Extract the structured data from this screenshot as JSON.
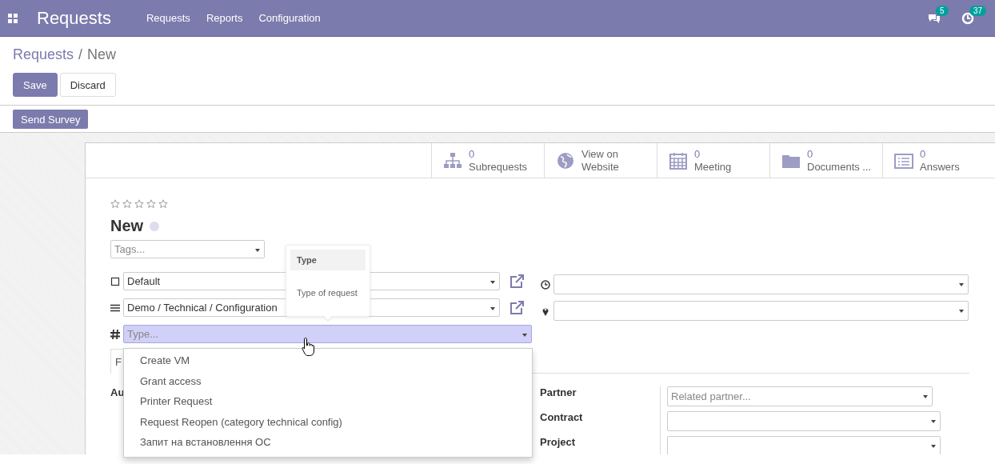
{
  "navbar": {
    "app_title": "Requests",
    "menu": [
      {
        "label": "Requests"
      },
      {
        "label": "Reports"
      },
      {
        "label": "Configuration"
      }
    ],
    "systray": [
      {
        "kind": "chat",
        "badge": "5"
      },
      {
        "kind": "activity",
        "badge": "37"
      }
    ]
  },
  "breadcrumb": [
    {
      "kind": "link",
      "text": "Requests"
    },
    {
      "kind": "separator",
      "text": "/"
    },
    {
      "kind": "current",
      "text": "New"
    }
  ],
  "buttons": [
    {
      "label": "Save",
      "kind": "primary"
    },
    {
      "label": "Discard",
      "kind": "secondary"
    }
  ],
  "action_buttons": [
    {
      "label": "Send Survey"
    }
  ],
  "stat_buttons": [
    {
      "kind": "subrequests",
      "value": "0",
      "label": "Subrequests"
    },
    {
      "kind": "website",
      "label": "View on Website"
    },
    {
      "kind": "meeting",
      "value": "0",
      "label": "Meeting"
    },
    {
      "kind": "documents",
      "value": "0",
      "label": "Documents ..."
    },
    {
      "kind": "answers",
      "value": "0",
      "label": "Answers"
    }
  ],
  "form": {
    "stars": 0,
    "title": "New",
    "tags": {
      "placeholder": "Tags..."
    },
    "left_fields": [
      {
        "kind": "square",
        "value": "Default",
        "external_link": true,
        "focused": false
      },
      {
        "kind": "bars",
        "value": "Demo / Technical / Configuration",
        "external_link": true,
        "focused": false
      },
      {
        "kind": "hash",
        "placeholder": "Type...",
        "external_link": false,
        "focused": true
      }
    ],
    "right_fields": [
      {
        "kind": "clock"
      },
      {
        "kind": "pin"
      }
    ],
    "tooltip": {
      "title": "Type",
      "text": "Type of request"
    },
    "dropdown": [
      "Create VM",
      "Grant access",
      "Printer Request",
      "Request Reopen (category technical config)",
      "Запит на встановлення ОС"
    ],
    "tabs": [
      {
        "label": "F",
        "selected": true
      }
    ],
    "left_labels": [
      "Au"
    ],
    "right_group": [
      {
        "label": "Partner",
        "placeholder": "Related partner..."
      },
      {
        "label": "Contract"
      },
      {
        "label": "Project"
      }
    ]
  }
}
